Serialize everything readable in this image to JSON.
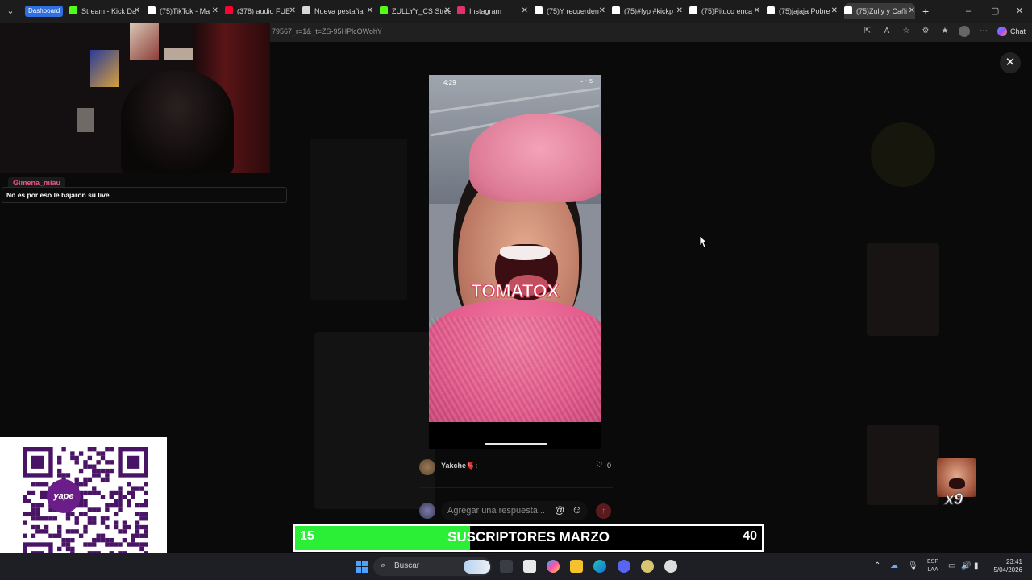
{
  "browser": {
    "tab_menu_icon": "chevron-down-icon",
    "dashboard_badge": "Dashboard",
    "tabs": [
      {
        "label": "Stream - Kick Da",
        "icon": "kick-icon",
        "color": "#53fc18"
      },
      {
        "label": "(75)TikTok - Ma",
        "icon": "tiktok-icon",
        "color": "#ffffff"
      },
      {
        "label": "(378) audio FUE",
        "icon": "youtube-icon",
        "color": "#ff0033"
      },
      {
        "label": "Nueva pestaña",
        "icon": "newtab-icon",
        "color": "#d8d8d8"
      },
      {
        "label": "ZULLYY_CS Strea",
        "icon": "kick-icon",
        "color": "#53fc18"
      },
      {
        "label": "Instagram",
        "icon": "instagram-icon",
        "color": "#e1306c"
      },
      {
        "label": "(75)Y recuerden",
        "icon": "tiktok-icon",
        "color": "#ffffff"
      },
      {
        "label": "(75)#fyp #kickp",
        "icon": "tiktok-icon",
        "color": "#ffffff"
      },
      {
        "label": "(75)Pituco enca",
        "icon": "tiktok-icon",
        "color": "#ffffff"
      },
      {
        "label": "(75)jajaja Pobre",
        "icon": "tiktok-icon",
        "color": "#ffffff"
      },
      {
        "label": "(75)Zully y Cañi",
        "icon": "tiktok-icon",
        "color": "#ffffff"
      }
    ],
    "new_tab": "+",
    "window_controls": [
      "–",
      "▢",
      "✕"
    ],
    "url": "79567_r=1&_t=ZS-95HPlcOWohY",
    "chat_label": "Chat"
  },
  "video": {
    "status_time": "4:29",
    "status_icons": "▪ ◔ 5",
    "caption": "TOMATOX"
  },
  "overlay": {
    "close": "✕"
  },
  "comment": {
    "username": "Yakche🫀:",
    "likes": "0"
  },
  "reply": {
    "placeholder": "Agregar una respuesta...",
    "at": "@",
    "emoji": "☺",
    "send": "↑"
  },
  "stream_chat": {
    "username": "Gimena_miau",
    "message": "No es por eso le bajaron su live"
  },
  "qr": {
    "brand": "yape"
  },
  "subscribers": {
    "current": "15",
    "title": "SUSCRIPTORES MARZO",
    "goal": "40",
    "progress": 0.375,
    "fill_color": "#2bef37"
  },
  "emote": {
    "multiplier": "x9"
  },
  "taskbar": {
    "search_label": "Buscar",
    "lang_top": "ESP",
    "lang_bottom": "LAA",
    "time": "23:41",
    "date": "5/04/2026"
  }
}
